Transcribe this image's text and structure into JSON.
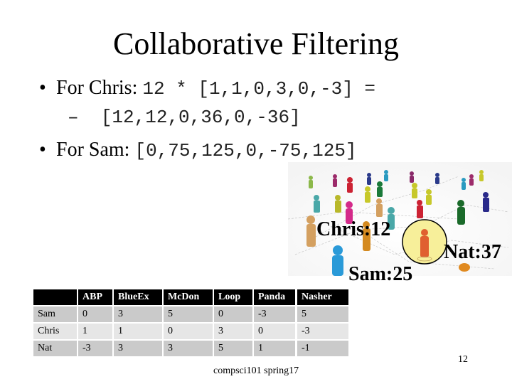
{
  "slide": {
    "title": "Collaborative Filtering",
    "bullets": [
      {
        "label": "For Chris: ",
        "code": "12 * [1,1,0,3,0,-3] ="
      },
      {
        "label": "For Sam: ",
        "code": "[0,75,125,0,-75,125]"
      }
    ],
    "sub_bullet": {
      "dash": "–",
      "code": "[12,12,0,36,0,-36]"
    },
    "bullet_glyph": "•"
  },
  "illustration": {
    "labels": {
      "chris": "Chris:12",
      "sam": "Sam:25",
      "nat": "Nat:37"
    },
    "highlight_color": "#f7ef9a"
  },
  "table": {
    "columns": [
      "",
      "ABP",
      "BlueEx",
      "McDon",
      "Loop",
      "Panda",
      "Nasher"
    ],
    "rows": [
      {
        "name": "Sam",
        "values": [
          "0",
          "3",
          "5",
          "0",
          "-3",
          "5"
        ]
      },
      {
        "name": "Chris",
        "values": [
          "1",
          "1",
          "0",
          "3",
          "0",
          "-3"
        ]
      },
      {
        "name": "Nat",
        "values": [
          "-3",
          "3",
          "3",
          "5",
          "1",
          "-1"
        ]
      }
    ]
  },
  "footer": {
    "text": "compsci101 spring17",
    "page_number": "12"
  }
}
